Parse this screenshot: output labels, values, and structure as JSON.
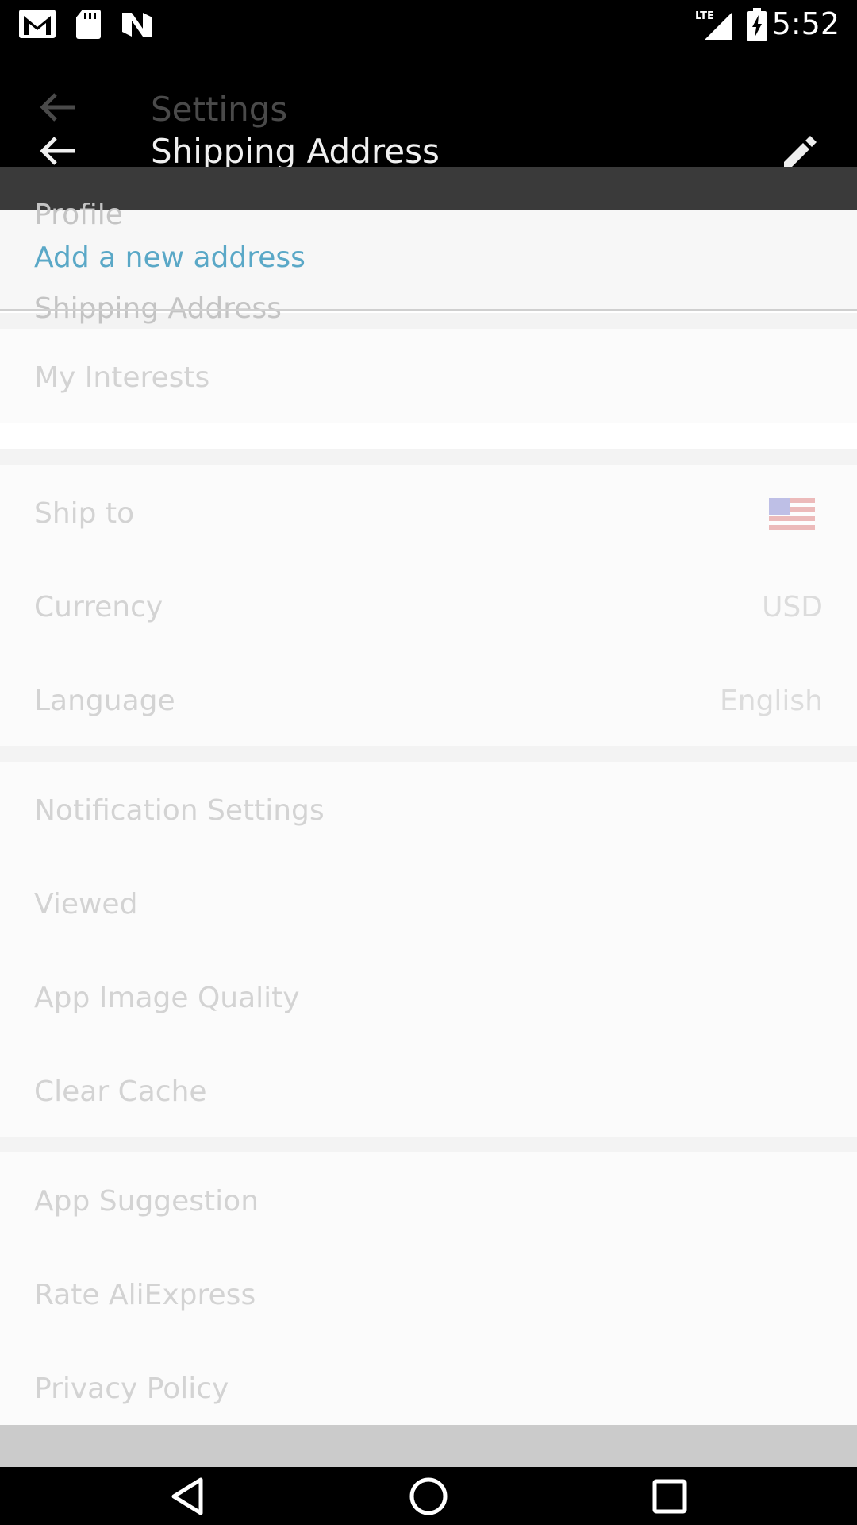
{
  "status_bar": {
    "time": "5:52",
    "network": "LTE",
    "icons": [
      "gmail-icon",
      "sd-card-icon",
      "n-icon",
      "lte-signal-icon",
      "battery-charging-icon"
    ]
  },
  "toolbar": {
    "ghost_title": "Settings",
    "title": "Shipping Address",
    "back_icon": "arrow-left-icon",
    "edit_icon": "pencil-icon"
  },
  "overlay": {
    "add_address": "Add a new address",
    "accent_color": "#5aa8c7"
  },
  "settings": {
    "profile": "Profile",
    "shipping_address": "Shipping Address",
    "my_interests": "My Interests",
    "ship_to": "Ship to",
    "ship_to_flag": "us-flag-icon",
    "currency": "Currency",
    "currency_value": "USD",
    "language": "Language",
    "language_value": "English",
    "notification_settings": "Notification Settings",
    "viewed": "Viewed",
    "app_image_quality": "App Image Quality",
    "clear_cache": "Clear Cache",
    "app_suggestion": "App Suggestion",
    "rate": "Rate AliExpress",
    "privacy_policy": "Privacy Policy"
  },
  "navbar": {
    "back": "nav-back-icon",
    "home": "nav-home-icon",
    "recents": "nav-recents-icon"
  }
}
